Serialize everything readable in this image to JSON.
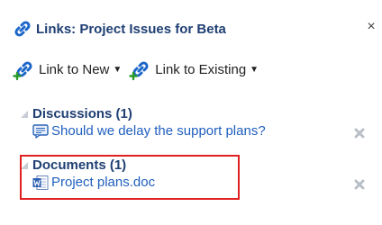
{
  "header": {
    "title": "Links: Project Issues for Beta",
    "close_label": "×"
  },
  "toolbar": {
    "link_new_label": "Link to New",
    "link_existing_label": "Link to Existing",
    "caret": "▼"
  },
  "sections": {
    "discussions": {
      "title": "Discussions (1)",
      "item": "Should we delay the support plans?"
    },
    "documents": {
      "title": "Documents (1)",
      "item": "Project plans.doc"
    }
  },
  "colors": {
    "title": "#1f3f73",
    "link": "#1f5fbf",
    "highlight": "#e02020"
  },
  "icons": [
    "chain-link-icon",
    "add-link-icon",
    "discussion-icon",
    "word-document-icon",
    "remove-icon",
    "expand-triangle-icon"
  ]
}
